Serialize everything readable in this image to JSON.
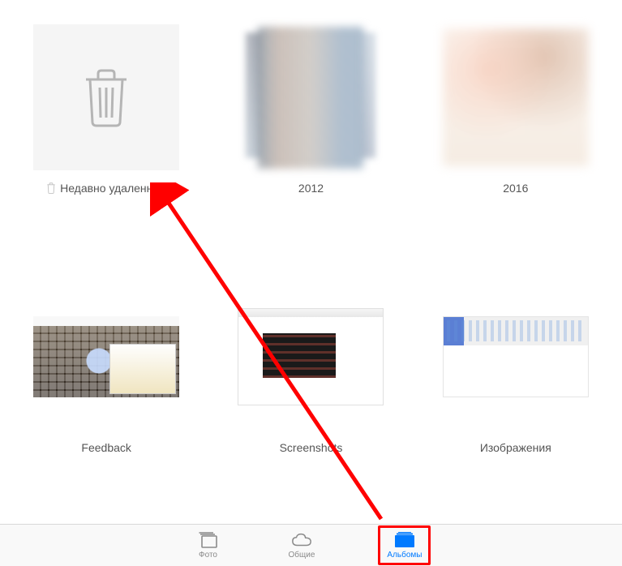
{
  "albums": [
    {
      "id": "recently-deleted",
      "label": "Недавно удаленные",
      "has_trash_icon": true,
      "thumb_type": "trash"
    },
    {
      "id": "2012",
      "label": "2012",
      "thumb_type": "photo-2012"
    },
    {
      "id": "2016",
      "label": "2016",
      "thumb_type": "photo-2016"
    },
    {
      "id": "feedback",
      "label": "Feedback",
      "thumb_type": "feedback"
    },
    {
      "id": "screenshots",
      "label": "Screenshots",
      "thumb_type": "screenshots"
    },
    {
      "id": "images",
      "label": "Изображения",
      "thumb_type": "images"
    }
  ],
  "tabs": {
    "photos": {
      "label": "Фото",
      "active": false
    },
    "shared": {
      "label": "Общие",
      "active": false
    },
    "albums": {
      "label": "Альбомы",
      "active": true,
      "highlighted": true
    }
  },
  "colors": {
    "active_blue": "#007aff",
    "inactive_gray": "#8a8a8a",
    "annotation_red": "#ff0000"
  }
}
